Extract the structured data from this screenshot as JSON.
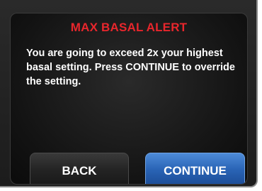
{
  "alert": {
    "title": "MAX BASAL ALERT",
    "message": "You are going to exceed 2x your highest basal setting. Press CONTINUE to override the setting."
  },
  "buttons": {
    "back_label": "BACK",
    "continue_label": "CONTINUE"
  },
  "colors": {
    "title": "#e8262c",
    "text": "#ffffff",
    "screen_background": "#131313",
    "back_button": "#242424",
    "continue_button": "#2a64b6"
  }
}
